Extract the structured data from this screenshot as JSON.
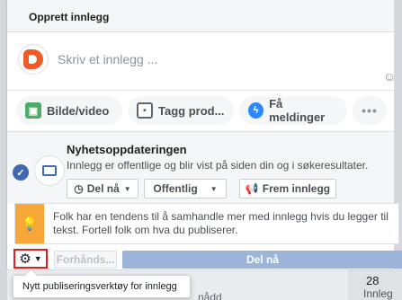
{
  "card": {
    "title": "Opprett innlegg"
  },
  "composer": {
    "placeholder": "Skriv et innlegg ..."
  },
  "actions": {
    "photo_label": "Bilde/video",
    "tag_label": "Tagg prod...",
    "messages_label": "Få meldinger",
    "more_label": "•••"
  },
  "news_feed": {
    "title": "Nyhetsoppdateringen",
    "description": "Innlegg er offentlige og blir vist på siden din og i søkeresultater.",
    "publish_select": "Del nå",
    "audience_select": "Offentlig",
    "boost_label": "Frem innlegg"
  },
  "tip": {
    "text": "Folk har en tendens til å samhandle mer med innlegg hvis du legger til tekst. Fortell folk om hva du publiserer."
  },
  "footer": {
    "preview_label": "Forhånds...",
    "share_label": "Del nå"
  },
  "tooltip": {
    "text": "Nytt publiseringsverktøy for innlegg"
  },
  "background": {
    "number": "28",
    "word": "Innleg",
    "word2": "nådd"
  },
  "colors": {
    "accent": "#4267b2",
    "highlight": "#e02020",
    "tip": "#f7a738",
    "share_disabled": "#9cb4d8"
  }
}
